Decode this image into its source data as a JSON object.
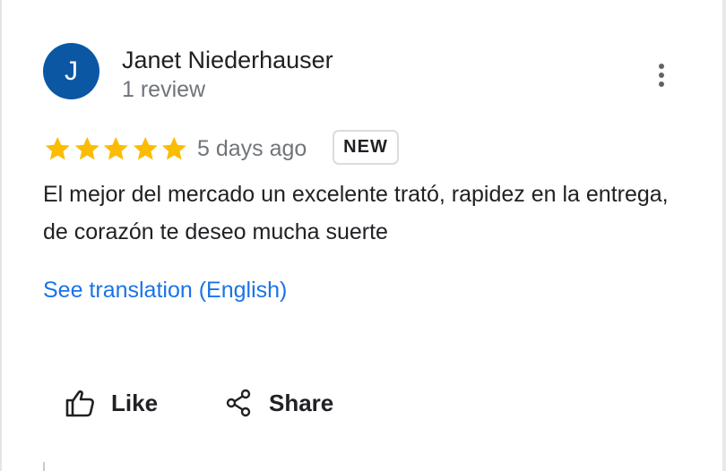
{
  "reviewer": {
    "initial": "J",
    "name": "Janet Niederhauser",
    "review_count": "1 review",
    "avatar_color": "#0b57a4"
  },
  "review": {
    "rating": 5,
    "max_rating": 5,
    "star_color": "#fbbc04",
    "time_ago": "5 days ago",
    "badge": "NEW",
    "text": "El mejor del mercado un excelente trató, rapidez en la entrega, de corazón te deseo mucha suerte",
    "translation_link": "See translation (English)"
  },
  "actions": {
    "like_label": "Like",
    "share_label": "Share"
  },
  "icons": {
    "menu": "more-vertical-icon",
    "like": "thumbs-up-icon",
    "share": "share-icon",
    "rating": "star-icon"
  }
}
